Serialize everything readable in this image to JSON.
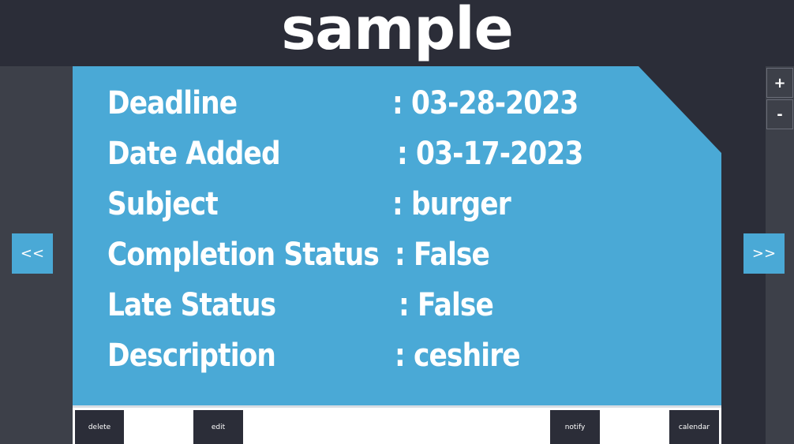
{
  "header": {
    "title": "sample"
  },
  "task": {
    "rows": [
      {
        "label": "Deadline",
        "value": ": 03-28-2023"
      },
      {
        "label": "Date Added",
        "value": ": 03-17-2023"
      },
      {
        "label": "Subject",
        "value": ": burger"
      },
      {
        "label": "Completion Status",
        "value": ": False"
      },
      {
        "label": "Late Status",
        "value": ": False"
      },
      {
        "label": "Description",
        "value": ": ceshire"
      }
    ]
  },
  "nav": {
    "prev_label": "<<",
    "next_label": ">>"
  },
  "zoom": {
    "in_label": "+",
    "out_label": "-"
  },
  "actions": {
    "delete_label": "delete",
    "edit_label": "edit",
    "notify_label": "notify",
    "calendar_label": "calendar"
  },
  "colors": {
    "accent": "#4aa9d6",
    "dark": "#2b2d38",
    "panel": "#3d4049"
  }
}
